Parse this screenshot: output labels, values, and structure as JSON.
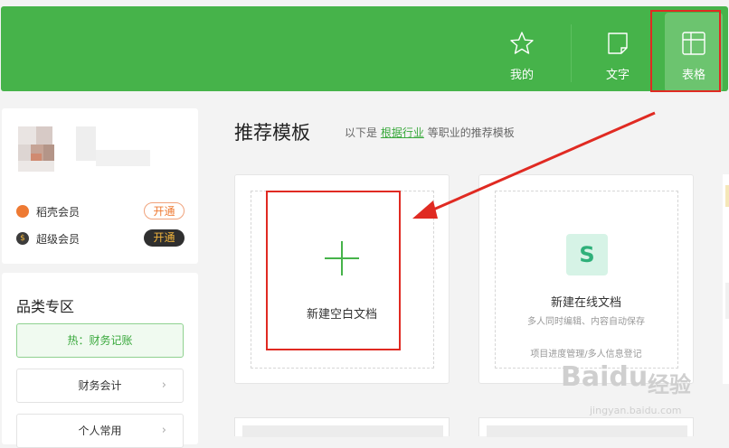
{
  "nav": {
    "items": [
      {
        "label": "我的",
        "icon": "star-icon"
      },
      {
        "label": "文字",
        "icon": "document-icon"
      },
      {
        "label": "表格",
        "icon": "spreadsheet-icon",
        "active": true
      }
    ]
  },
  "user": {
    "memberships": [
      {
        "label": "稻壳会员",
        "button": "开通",
        "style": "outline"
      },
      {
        "label": "超级会员",
        "button": "开通",
        "style": "dark"
      }
    ]
  },
  "categories": {
    "title": "品类专区",
    "items": [
      {
        "label": "热：财务记账",
        "hot": true
      },
      {
        "label": "财务会计",
        "hot": false
      },
      {
        "label": "个人常用",
        "hot": false
      }
    ]
  },
  "main": {
    "title": "推荐模板",
    "subtitle_prefix": "以下是",
    "subtitle_link": "根据行业",
    "subtitle_suffix": "等职业的推荐模板"
  },
  "templates": {
    "blank": {
      "label": "新建空白文档"
    },
    "online": {
      "label": "新建在线文档",
      "desc": "多人同时编辑、内容自动保存",
      "tags": "项目进度管理/多人信息登记",
      "icon_letter": "S"
    }
  },
  "watermark": {
    "brand": "Baidu",
    "cn": "经验",
    "url": "jingyan.baidu.com"
  },
  "colors": {
    "brand_green": "#46b34a",
    "annotation_red": "#e02a22",
    "super_gold": "#f0b43c"
  }
}
